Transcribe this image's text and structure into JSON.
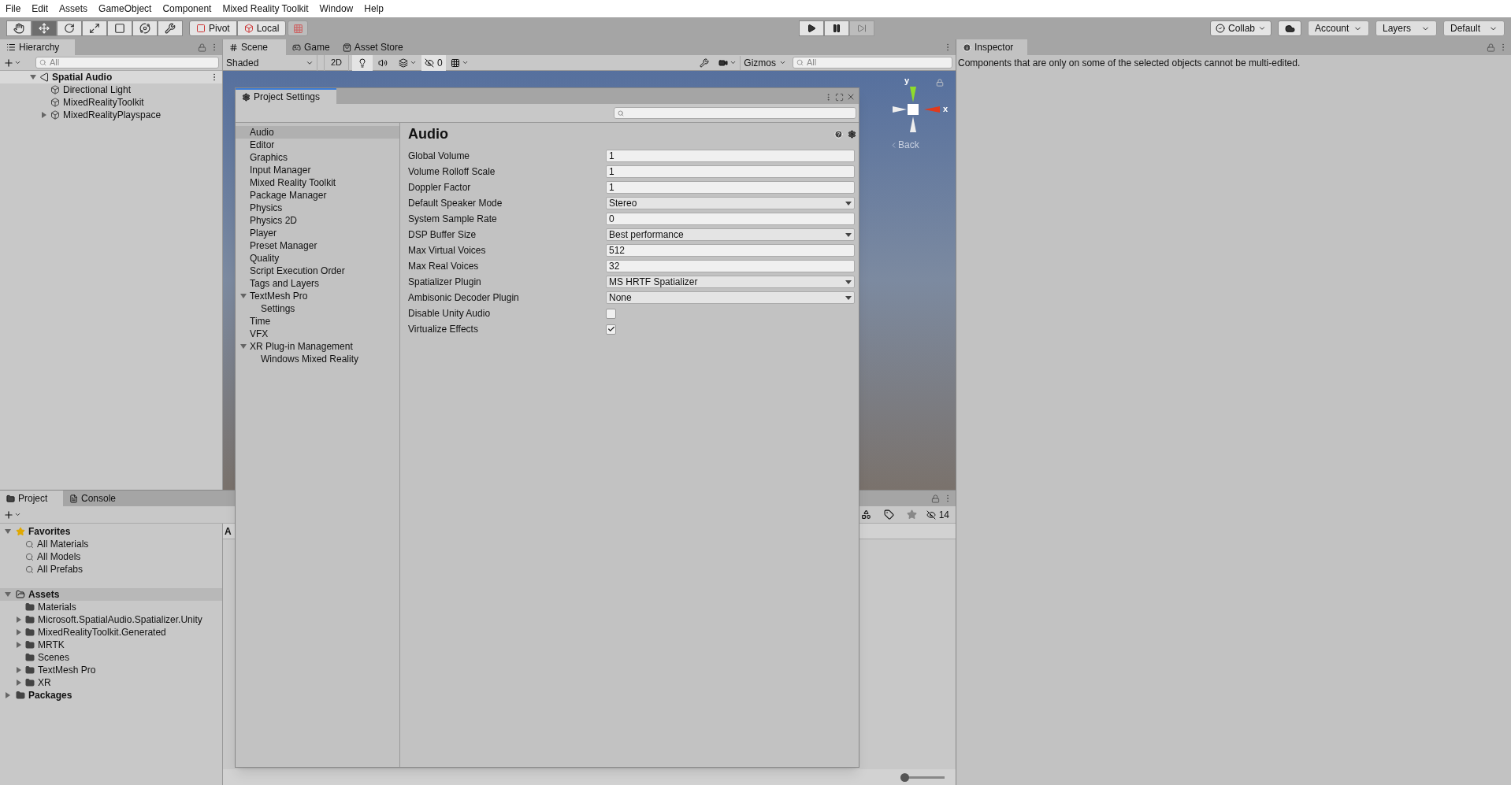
{
  "menu": [
    "File",
    "Edit",
    "Assets",
    "GameObject",
    "Component",
    "Mixed Reality Toolkit",
    "Window",
    "Help"
  ],
  "toolbar": {
    "tools": [
      {
        "kind": "hand",
        "selected": false
      },
      {
        "kind": "move",
        "selected": true
      },
      {
        "kind": "rotate",
        "selected": false
      },
      {
        "kind": "scale",
        "selected": false
      },
      {
        "kind": "rect",
        "selected": false
      },
      {
        "kind": "transform",
        "selected": false
      },
      {
        "kind": "custom",
        "selected": false
      }
    ],
    "pivot": "Pivot",
    "local": "Local",
    "collab": "Collab",
    "account": "Account",
    "layers": "Layers",
    "layout": "Default"
  },
  "hierarchy": {
    "title": "Hierarchy",
    "search_placeholder": "All",
    "tree": [
      {
        "label": "Spatial Audio",
        "expanded": true,
        "children": [
          {
            "label": "Directional Light"
          },
          {
            "label": "MixedRealityToolkit"
          },
          {
            "label": "MixedRealityPlayspace",
            "expanded": false
          }
        ]
      }
    ]
  },
  "scene": {
    "tabs": [
      {
        "label": "Scene",
        "selected": true
      },
      {
        "label": "Game",
        "selected": false
      },
      {
        "label": "Asset Store",
        "selected": false
      }
    ],
    "shading": "Shaded",
    "mode_2d": "2D",
    "hidden_count": "0",
    "gizmos": "Gizmos",
    "search_placeholder": "All",
    "axis_y": "y",
    "axis_x": "x",
    "view": "Back"
  },
  "inspector": {
    "title": "Inspector",
    "message": "Components that are only on some of the selected objects cannot be multi-edited."
  },
  "project": {
    "tabs": [
      {
        "label": "Project",
        "selected": true
      },
      {
        "label": "Console",
        "selected": false
      }
    ],
    "favorites": {
      "label": "Favorites",
      "items": [
        "All Materials",
        "All Models",
        "All Prefabs"
      ]
    },
    "assets": {
      "label": "Assets",
      "children": [
        {
          "label": "Materials"
        },
        {
          "label": "Microsoft.SpatialAudio.Spatializer.Unity",
          "expanded": false
        },
        {
          "label": "MixedRealityToolkit.Generated",
          "expanded": false
        },
        {
          "label": "MRTK",
          "expanded": false
        },
        {
          "label": "Scenes"
        },
        {
          "label": "TextMesh Pro",
          "expanded": false
        },
        {
          "label": "XR",
          "expanded": false
        }
      ]
    },
    "packages": "Packages",
    "column_header": "A",
    "hidden_count": "14",
    "zoom": {
      "level": 0
    }
  },
  "project_settings": {
    "title": "Project Settings",
    "nav": [
      {
        "label": "Audio",
        "selected": true
      },
      {
        "label": "Editor",
        "selected": false
      },
      {
        "label": "Graphics",
        "selected": false
      },
      {
        "label": "Input Manager",
        "selected": false
      },
      {
        "label": "Mixed Reality Toolkit",
        "selected": false
      },
      {
        "label": "Package Manager",
        "selected": false
      },
      {
        "label": "Physics",
        "selected": false
      },
      {
        "label": "Physics 2D",
        "selected": false
      },
      {
        "label": "Player",
        "selected": false
      },
      {
        "label": "Preset Manager",
        "selected": false
      },
      {
        "label": "Quality",
        "selected": false
      },
      {
        "label": "Script Execution Order",
        "selected": false
      },
      {
        "label": "Tags and Layers",
        "selected": false
      },
      {
        "label": "TextMesh Pro",
        "selected": false,
        "expanded": true,
        "children": [
          {
            "label": "Settings",
            "selected": false
          }
        ]
      },
      {
        "label": "Time",
        "selected": false
      },
      {
        "label": "VFX",
        "selected": false
      },
      {
        "label": "XR Plug-in Management",
        "selected": false,
        "expanded": true,
        "children": [
          {
            "label": "Windows Mixed Reality",
            "selected": false
          }
        ]
      }
    ],
    "heading": "Audio",
    "fields": [
      {
        "kind": "text",
        "label": "Global Volume",
        "value": "1"
      },
      {
        "kind": "text",
        "label": "Volume Rolloff Scale",
        "value": "1"
      },
      {
        "kind": "text",
        "label": "Doppler Factor",
        "value": "1"
      },
      {
        "kind": "dropdown",
        "label": "Default Speaker Mode",
        "value": "Stereo"
      },
      {
        "kind": "text",
        "label": "System Sample Rate",
        "value": "0"
      },
      {
        "kind": "dropdown",
        "label": "DSP Buffer Size",
        "value": "Best performance"
      },
      {
        "kind": "text",
        "label": "Max Virtual Voices",
        "value": "512"
      },
      {
        "kind": "text",
        "label": "Max Real Voices",
        "value": "32"
      },
      {
        "kind": "dropdown",
        "label": "Spatializer Plugin",
        "value": "MS HRTF Spatializer"
      },
      {
        "kind": "dropdown",
        "label": "Ambisonic Decoder Plugin",
        "value": "None"
      },
      {
        "kind": "checkbox",
        "label": "Disable Unity Audio",
        "checked": false
      },
      {
        "kind": "checkbox",
        "label": "Virtualize Effects",
        "checked": true
      }
    ]
  }
}
